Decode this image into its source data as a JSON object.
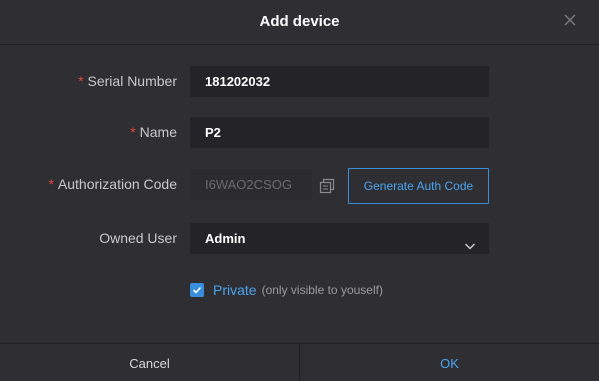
{
  "dialog": {
    "title": "Add device",
    "close_icon": "close-icon"
  },
  "fields": {
    "serial_number": {
      "label": "Serial Number",
      "required": "*",
      "value": "181202032"
    },
    "name": {
      "label": "Name",
      "required": "*",
      "value": "P2"
    },
    "authorization_code": {
      "label": "Authorization Code",
      "required": "*",
      "value": "I6WAO2CSOG",
      "copy_icon": "copy-icon"
    },
    "owned_user": {
      "label": "Owned User",
      "value": "Admin",
      "arrow_icon": "chevron-down-icon"
    }
  },
  "generate_button": {
    "label": "Generate Auth Code"
  },
  "private": {
    "checked": true,
    "label": "Private",
    "hint": "(only visible to youself)"
  },
  "footer": {
    "cancel_label": "Cancel",
    "ok_label": "OK"
  },
  "colors": {
    "background": "#2f2f33",
    "input_background": "#242428",
    "accent": "#4aa3ef",
    "required": "#e2453c"
  }
}
